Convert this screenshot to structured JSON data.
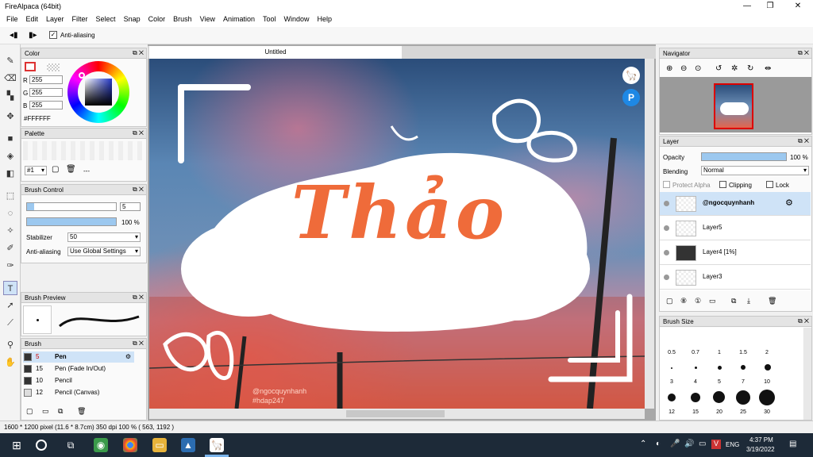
{
  "app": {
    "title": "FireAlpaca (64bit)"
  },
  "menu": [
    "File",
    "Edit",
    "Layer",
    "Filter",
    "Select",
    "Snap",
    "Color",
    "Brush",
    "View",
    "Animation",
    "Tool",
    "Window",
    "Help"
  ],
  "toolbar": {
    "antialias_label": "Anti-aliasing"
  },
  "color_panel": {
    "title": "Color",
    "r_label": "R",
    "g_label": "G",
    "b_label": "B",
    "r": "255",
    "g": "255",
    "b": "255",
    "hex": "#FFFFFF"
  },
  "palette_panel": {
    "title": "Palette",
    "selector": "#1",
    "dash": "---"
  },
  "brush_control": {
    "title": "Brush Control",
    "size": "5",
    "opacity": "100 %",
    "stabilizer_label": "Stabilizer",
    "stabilizer": "50",
    "aa_label": "Anti-aliasing",
    "aa_value": "Use Global Settings"
  },
  "brush_preview": {
    "title": "Brush Preview"
  },
  "brush_panel": {
    "title": "Brush",
    "items": [
      {
        "size": "5",
        "name": "Pen"
      },
      {
        "size": "15",
        "name": "Pen (Fade In/Out)"
      },
      {
        "size": "10",
        "name": "Pencil"
      },
      {
        "size": "12",
        "name": "Pencil (Canvas)"
      }
    ]
  },
  "canvas": {
    "tab": "Untitled",
    "artwork_text": "Thảo",
    "watermark1": "@ngocquynhanh",
    "watermark2": "#hdap247"
  },
  "navigator": {
    "title": "Navigator"
  },
  "layer_panel": {
    "title": "Layer",
    "opacity_label": "Opacity",
    "opacity": "100 %",
    "opacity_value": 1.0,
    "blending_label": "Blending",
    "blending": "Normal",
    "protect_alpha": "Protect Alpha",
    "clipping": "Clipping",
    "lock": "Lock",
    "layers": [
      {
        "name": "@ngocquynhanh"
      },
      {
        "name": "Layer5"
      },
      {
        "name": "Layer4 [1%]"
      },
      {
        "name": "Layer3"
      }
    ]
  },
  "brush_size": {
    "title": "Brush Size",
    "row1": [
      "0.5",
      "0.7",
      "1",
      "1.5",
      "2"
    ],
    "row2": [
      "3",
      "4",
      "5",
      "7",
      "10"
    ],
    "row3": [
      "12",
      "15",
      "20",
      "25",
      "30"
    ]
  },
  "status": "1600 * 1200 pixel  (11.6 * 8.7cm)  350 dpi  100 %  ( 563, 1192 )",
  "taskbar": {
    "lang": "ENG",
    "time": "4:37 PM",
    "date": "3/19/2022"
  }
}
